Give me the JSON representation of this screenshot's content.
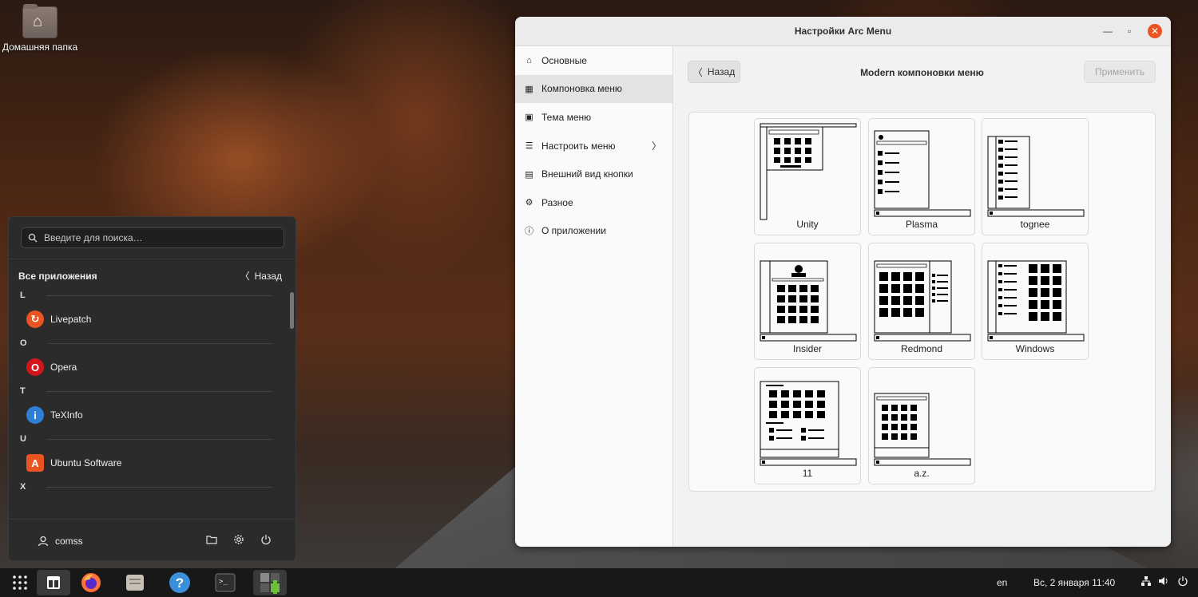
{
  "desktop": {
    "home_folder_label": "Домашняя папка"
  },
  "arcmenu": {
    "search_placeholder": "Введите для поиска…",
    "section_title": "Все приложения",
    "back_label": "Назад",
    "groups": [
      {
        "letter": "L",
        "apps": [
          {
            "name": "Livepatch",
            "icon": "livepatch-icon",
            "color": "#e95420"
          }
        ]
      },
      {
        "letter": "O",
        "apps": [
          {
            "name": "Opera",
            "icon": "opera-icon",
            "color": "#d3151c"
          }
        ]
      },
      {
        "letter": "T",
        "apps": [
          {
            "name": "TeXInfo",
            "icon": "info-icon",
            "color": "#2f7fd6"
          }
        ]
      },
      {
        "letter": "U",
        "apps": [
          {
            "name": "Ubuntu Software",
            "icon": "ubuntu-software-icon",
            "color": "#e95420"
          }
        ]
      },
      {
        "letter": "X",
        "apps": []
      }
    ],
    "user_name": "comss"
  },
  "window": {
    "title": "Настройки Arc Menu",
    "sidebar": [
      {
        "label": "Основные",
        "icon": "home-icon"
      },
      {
        "label": "Компоновка меню",
        "icon": "layout-icon",
        "active": true
      },
      {
        "label": "Тема меню",
        "icon": "theme-icon"
      },
      {
        "label": "Настроить меню",
        "icon": "customize-icon",
        "has_arrow": true
      },
      {
        "label": "Внешний вид кнопки",
        "icon": "button-appearance-icon"
      },
      {
        "label": "Разное",
        "icon": "misc-icon"
      },
      {
        "label": "О приложении",
        "icon": "about-icon"
      }
    ],
    "back_label": "Назад",
    "page_title": "Modern компоновки меню",
    "apply_label": "Применить",
    "layouts": [
      "Unity",
      "Plasma",
      "tognee",
      "Insider",
      "Redmond",
      "Windows",
      "11",
      "a.z."
    ]
  },
  "taskbar": {
    "apps": [
      "apps-grid-icon",
      "arcmenu-icon",
      "firefox-icon",
      "files-icon",
      "help-icon",
      "terminal-icon",
      "extensions-icon"
    ],
    "keyboard_layout": "en",
    "datetime": "Вс, 2 января  11:40"
  },
  "colors": {
    "accent": "#e95420",
    "panel_dark": "#2b2b2b",
    "taskbar": "#181818"
  }
}
